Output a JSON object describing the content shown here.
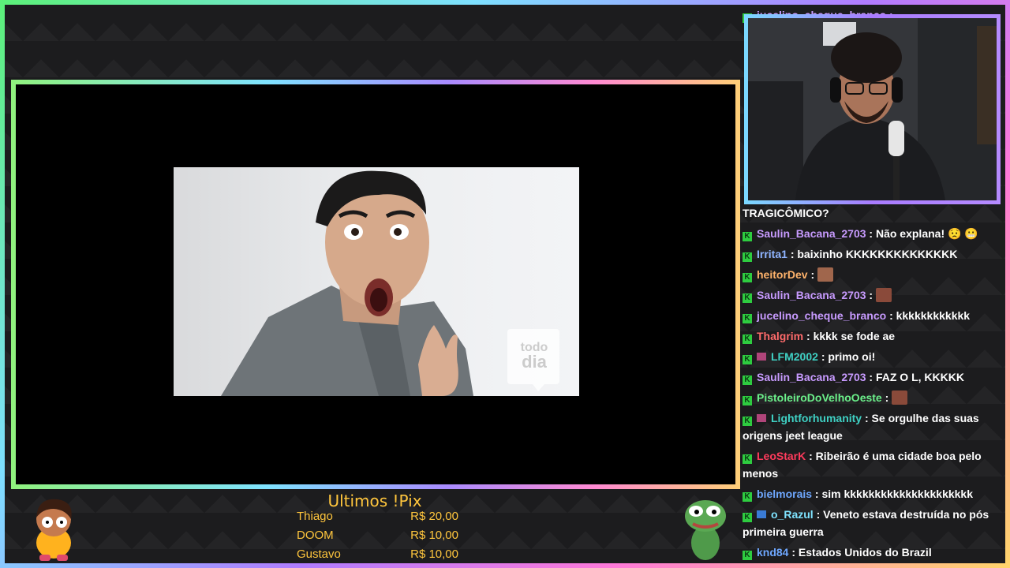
{
  "chat": {
    "top_partial": "jucelino_cheque_branco :",
    "cut_text": "TRAGICÔMICO?",
    "messages": [
      {
        "user": "Saulin_Bacana_2703",
        "color": "#c89bff",
        "text": ": Não explana! 😟 😬",
        "badge": "k"
      },
      {
        "user": "Irrita1",
        "color": "#8fb4ff",
        "text": ": baixinho KKKKKKKKKKKKKK",
        "badge": "k"
      },
      {
        "user": "heitorDev",
        "color": "#ffb36b",
        "text": ":",
        "badge": "k",
        "emote": "#a0664c"
      },
      {
        "user": "Saulin_Bacana_2703",
        "color": "#c89bff",
        "text": ":",
        "badge": "k",
        "emote": "#8a4a3a"
      },
      {
        "user": "jucelino_cheque_branco",
        "color": "#c89bff",
        "text": ": kkkkkkkkkkkk",
        "badge": "k"
      },
      {
        "user": "Thalgrim",
        "color": "#ff6b6b",
        "text": ": kkkk se fode ae",
        "badge": "k"
      },
      {
        "user": "LFM2002",
        "color": "#3fd1c4",
        "text": ": primo oi!",
        "badge": "k",
        "badge2": "#b0457a"
      },
      {
        "user": "Saulin_Bacana_2703",
        "color": "#c89bff",
        "text": ": FAZ O L, KKKKK",
        "badge": "k"
      },
      {
        "user": "PistoleiroDoVelhoOeste",
        "color": "#6bf08a",
        "text": ":",
        "badge": "k",
        "emote": "#8a4a3a"
      },
      {
        "user": "Lightforhumanity",
        "color": "#3fd1c4",
        "text": ": Se orgulhe das suas origens jeet league",
        "badge": "k",
        "badge2": "#b0457a"
      },
      {
        "user": "LeoStarK",
        "color": "#ff3b5c",
        "text": ": Ribeirão é uma cidade boa pelo menos",
        "badge": "k"
      },
      {
        "user": "bielmorais",
        "color": "#6fa8ff",
        "text": ": sim kkkkkkkkkkkkkkkkkkkkk",
        "badge": "k"
      },
      {
        "user": "o_Razul",
        "color": "#7fe3ff",
        "text": ": Veneto estava destruída no pós primeira guerra",
        "badge": "k",
        "badge2": "#3a7bd5"
      },
      {
        "user": "knd84",
        "color": "#6fa8ff",
        "text": ": Estados Unidos do Brazil",
        "badge": "k"
      }
    ]
  },
  "video": {
    "watermark_line1": "todo",
    "watermark_line2": "dia"
  },
  "pix": {
    "title": "Ultimos !Pix",
    "entries": [
      {
        "name": "Thiago",
        "value": "R$ 20,00"
      },
      {
        "name": "DOOM",
        "value": "R$ 10,00"
      },
      {
        "name": "Gustavo",
        "value": "R$ 10,00"
      }
    ]
  },
  "colors": {
    "pix_text": "#ffc63d",
    "badge_green": "#2ecc40"
  }
}
